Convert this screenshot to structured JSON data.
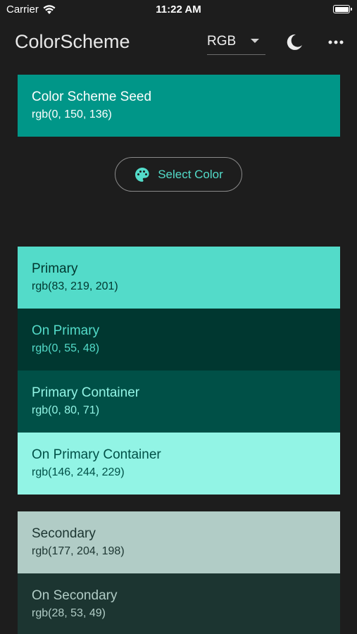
{
  "status_bar": {
    "carrier": "Carrier",
    "time": "11:22 AM"
  },
  "app_bar": {
    "title": "ColorScheme",
    "format_value": "RGB"
  },
  "seed": {
    "name": "Color Scheme Seed",
    "value": "rgb(0, 150, 136)",
    "color": "#009688"
  },
  "select_color_label": "Select Color",
  "swatches": [
    {
      "name": "Primary",
      "value": "rgb(83, 219, 201)",
      "bg": "#53dbc9",
      "fg": "#00372f"
    },
    {
      "name": "On Primary",
      "value": "rgb(0, 55, 48)",
      "bg": "#003730",
      "fg": "#53dbc9"
    },
    {
      "name": "Primary Container",
      "value": "rgb(0, 80, 71)",
      "bg": "#005047",
      "fg": "#92f4e5"
    },
    {
      "name": "On Primary Container",
      "value": "rgb(146, 244, 229)",
      "bg": "#92f4e5",
      "fg": "#005047"
    },
    {
      "name": "Secondary",
      "value": "rgb(177, 204, 198)",
      "bg": "#b1ccc6",
      "fg": "#1c3531"
    },
    {
      "name": "On Secondary",
      "value": "rgb(28, 53, 49)",
      "bg": "#1c3531",
      "fg": "#b1ccc6"
    }
  ]
}
